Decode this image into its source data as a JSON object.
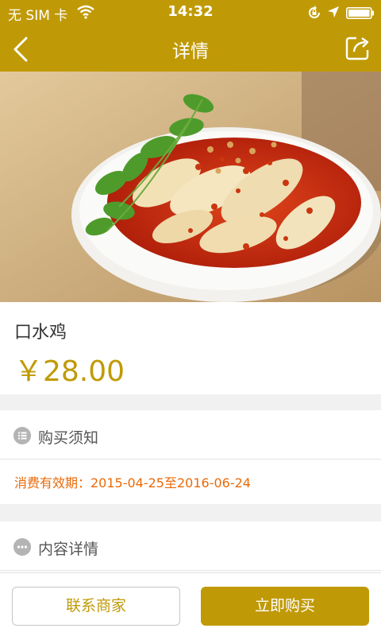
{
  "status_bar": {
    "carrier": "无 SIM 卡",
    "time": "14:32"
  },
  "nav": {
    "title": "详情"
  },
  "product": {
    "name": "口水鸡",
    "price": "￥28.00"
  },
  "purchase_notice": {
    "title": "购买须知",
    "validity": "消费有效期：2015-04-25至2016-06-24"
  },
  "content_details": {
    "title": "内容详情"
  },
  "actions": {
    "contact_label": "联系商家",
    "buy_label": "立即购买"
  },
  "colors": {
    "brand": "#c09a06",
    "validity_text": "#ea6a08"
  }
}
